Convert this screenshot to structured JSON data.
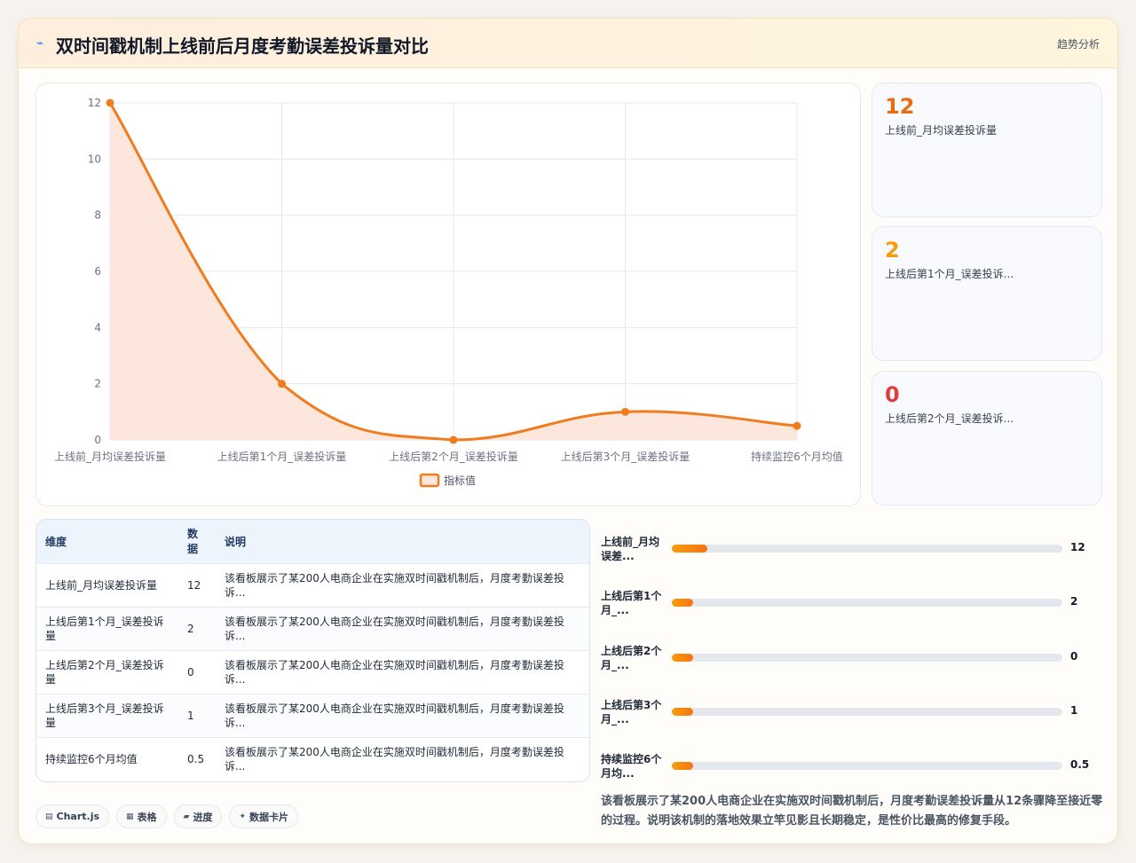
{
  "header": {
    "icon": "trend-icon",
    "title": "双时间戳机制上线前后月度考勤误差投诉量对比",
    "tag": "趋势分析"
  },
  "chart_data": {
    "type": "line",
    "categories": [
      "上线前_月均误差投诉量",
      "上线后第1个月_误差投诉量",
      "上线后第2个月_误差投诉量",
      "上线后第3个月_误差投诉量",
      "持续监控6个月均值"
    ],
    "series": [
      {
        "name": "指标值",
        "values": [
          12,
          2,
          0,
          1,
          0.5
        ]
      }
    ],
    "ylim": [
      0,
      12
    ],
    "yticks": [
      "0",
      "2",
      "4",
      "6",
      "8",
      "10",
      "12"
    ],
    "grid": true,
    "legend": "bottom",
    "color": "#f07c1f",
    "fill": "#fde7dc"
  },
  "kpis": [
    {
      "value": "12",
      "label": "上线前_月均误差投诉量",
      "color": "#ea6c12"
    },
    {
      "value": "2",
      "label": "上线后第1个月_误差投诉...",
      "color": "#f59e0b"
    },
    {
      "value": "0",
      "label": "上线后第2个月_误差投诉...",
      "color": "#e03e3e"
    }
  ],
  "table": {
    "headers": [
      "维度",
      "数据",
      "说明"
    ],
    "rows": [
      {
        "dim": "上线前_月均误差投诉量",
        "val": "12",
        "desc": "该看板展示了某200人电商企业在实施双时间戳机制后，月度考勤误差投诉..."
      },
      {
        "dim": "上线后第1个月_误差投诉量",
        "val": "2",
        "desc": "该看板展示了某200人电商企业在实施双时间戳机制后，月度考勤误差投诉..."
      },
      {
        "dim": "上线后第2个月_误差投诉量",
        "val": "0",
        "desc": "该看板展示了某200人电商企业在实施双时间戳机制后，月度考勤误差投诉..."
      },
      {
        "dim": "上线后第3个月_误差投诉量",
        "val": "1",
        "desc": "该看板展示了某200人电商企业在实施双时间戳机制后，月度考勤误差投诉..."
      },
      {
        "dim": "持续监控6个月均值",
        "val": "0.5",
        "desc": "该看板展示了某200人电商企业在实施双时间戳机制后，月度考勤误差投诉..."
      }
    ]
  },
  "progress": [
    {
      "label": "上线前_月均误差...",
      "value": "12",
      "fraction": 0.09
    },
    {
      "label": "上线后第1个月_...",
      "value": "2",
      "fraction": 0.055
    },
    {
      "label": "上线后第2个月_...",
      "value": "0",
      "fraction": 0.055
    },
    {
      "label": "上线后第3个月_...",
      "value": "1",
      "fraction": 0.055
    },
    {
      "label": "持续监控6个月均...",
      "value": "0.5",
      "fraction": 0.055
    }
  ],
  "summary": "该看板展示了某200人电商企业在实施双时间戳机制后，月度考勤误差投诉量从12条骤降至接近零的过程。说明该机制的落地效果立竿见影且长期稳定，是性价比最高的修复手段。",
  "chips": [
    {
      "icon": "chart-icon",
      "glyph": "▤",
      "label": "Chart.js"
    },
    {
      "icon": "table-icon",
      "glyph": "▦",
      "label": "表格"
    },
    {
      "icon": "progress-icon",
      "glyph": "▰",
      "label": "进度"
    },
    {
      "icon": "card-icon",
      "glyph": "✦",
      "label": "数据卡片"
    }
  ]
}
